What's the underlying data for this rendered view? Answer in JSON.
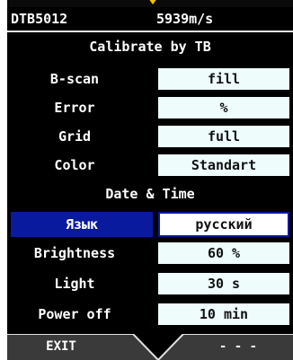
{
  "status": {
    "probe": "DTB5012",
    "velocity": "5939m/s"
  },
  "menu": {
    "calibrate": "Calibrate by TB",
    "rows": [
      {
        "label": "B-scan",
        "value": "fill"
      },
      {
        "label": "Error",
        "value": "%"
      },
      {
        "label": "Grid",
        "value": "full"
      },
      {
        "label": "Color",
        "value": "Standart"
      }
    ],
    "datetime": "Date & Time",
    "language": {
      "label": "Язык",
      "value": "русский"
    },
    "rows2": [
      {
        "label": "Brightness",
        "value": "60 %"
      },
      {
        "label": "Light",
        "value": "30 s"
      },
      {
        "label": "Power off",
        "value": "10 min"
      }
    ]
  },
  "footer": {
    "left": "EXIT",
    "right": "- - -"
  },
  "colors": {
    "accent": "#f2c400",
    "selection": "#0a1a9e",
    "field": "#eefcfc"
  },
  "icons": {
    "arrow": "down-arrow-icon"
  }
}
